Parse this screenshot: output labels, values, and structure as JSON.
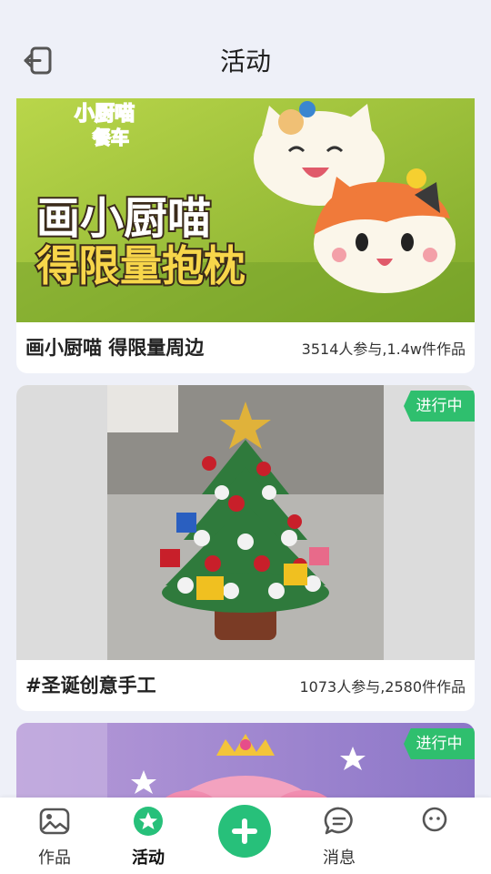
{
  "header": {
    "title": "活动",
    "back_icon": "logout-icon"
  },
  "cards": [
    {
      "banner_line1": "画小厨喵",
      "banner_line2": "得限量抱枕",
      "brand_line1": "小厨喵",
      "brand_line2": "餐车",
      "name": "画小厨喵 得限量周边",
      "stats": "3514人参与,1.4w件作品"
    },
    {
      "badge": "进行中",
      "name": "#圣诞创意手工",
      "stats": "1073人参与,2580件作品"
    },
    {
      "badge": "进行中"
    }
  ],
  "tabbar": {
    "items": [
      {
        "label": "作品",
        "icon": "image-icon"
      },
      {
        "label": "活动",
        "icon": "star-badge-icon",
        "active": true
      },
      {
        "label": "",
        "icon": "plus-icon"
      },
      {
        "label": "消息",
        "icon": "message-icon"
      },
      {
        "label": "",
        "icon": "face-icon"
      }
    ]
  },
  "colors": {
    "accent": "#27c07a",
    "ribbon": "#2fbf6e",
    "background": "#eef0f8"
  }
}
